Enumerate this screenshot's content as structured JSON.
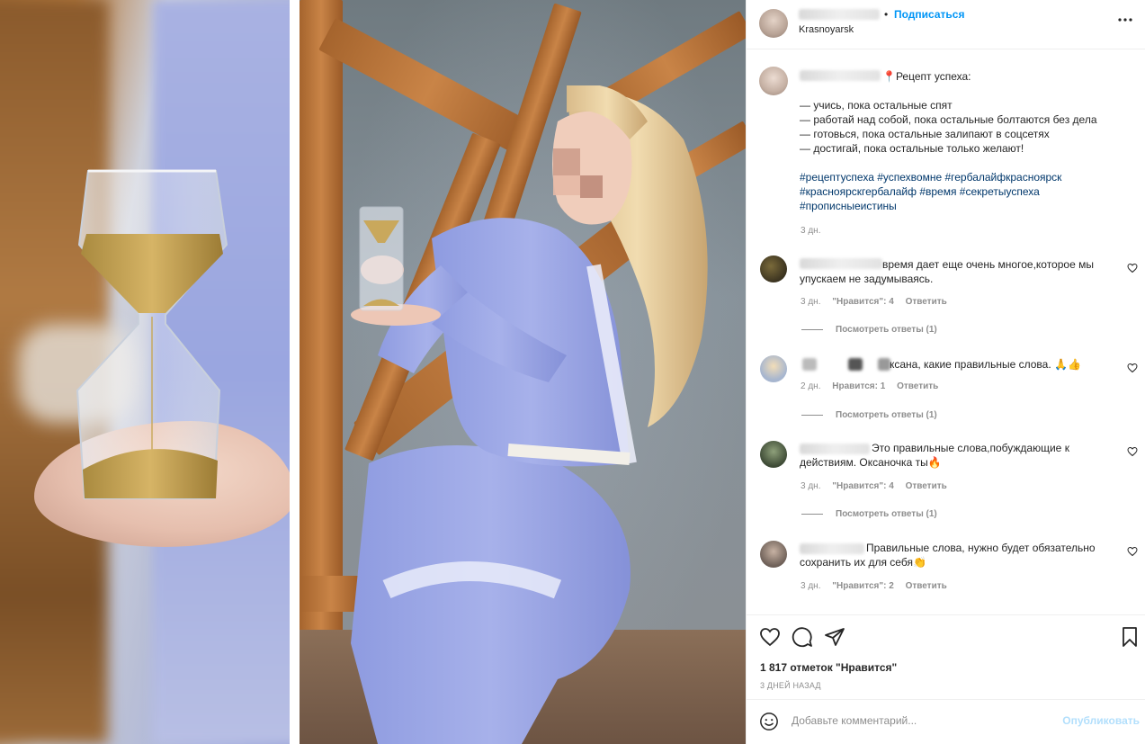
{
  "header": {
    "follow_separator": "•",
    "follow_label": "Подписаться",
    "location": "Krasnoyarsk",
    "more_icon": "more-horizontal-icon"
  },
  "caption": {
    "pin_emoji": "📍",
    "title": "Рецепт успеха:",
    "lines": [
      "— учись, пока остальные спят",
      "— работай над собой, пока остальные болтаются без дела",
      "— готовься, пока остальные залипают в соцсетях",
      "— достигай, пока остальные только желают!"
    ],
    "hashtag_lines": [
      "#рецептуспеха #успехвомне #гербалайфкрасноярск",
      "#красноярскгербалайф #время #секретыуспеха",
      "#прописныеистины"
    ],
    "time": "3 дн."
  },
  "comments": [
    {
      "text": "время дает еще очень многое,которое мы упускаем не задумываясь.",
      "time": "3 дн.",
      "likes": "\"Нравится\": 4",
      "reply": "Ответить",
      "view_replies": "Посмотреть ответы (1)"
    },
    {
      "text": "ксана, какие правильные слова. 🙏👍",
      "time": "2 дн.",
      "likes": "Нравится: 1",
      "reply": "Ответить",
      "view_replies": "Посмотреть ответы (1)"
    },
    {
      "text": "Это правильные слова,побуждающие к действиям. Оксаночка ты🔥",
      "time": "3 дн.",
      "likes": "\"Нравится\": 4",
      "reply": "Ответить",
      "view_replies": "Посмотреть ответы (1)"
    },
    {
      "text": "Правильные слова, нужно будет обязательно сохранить их для себя👏",
      "time": "3 дн.",
      "likes": "\"Нравится\": 2",
      "reply": "Ответить"
    }
  ],
  "actions": {
    "like_icon": "heart-icon",
    "comment_icon": "comment-icon",
    "share_icon": "share-icon",
    "save_icon": "bookmark-icon",
    "likes_count": "1 817 отметок \"Нравится\"",
    "posted_ago": "3 ДНЕЙ НАЗАД"
  },
  "add_comment": {
    "placeholder": "Добавьте комментарий...",
    "publish_label": "Опубликовать",
    "emoji_icon": "smiley-icon"
  },
  "colors": {
    "accent": "#0095f6",
    "publish_disabled": "#b2dffc",
    "hashtag": "#00376b",
    "muted": "#8e8e8e"
  }
}
